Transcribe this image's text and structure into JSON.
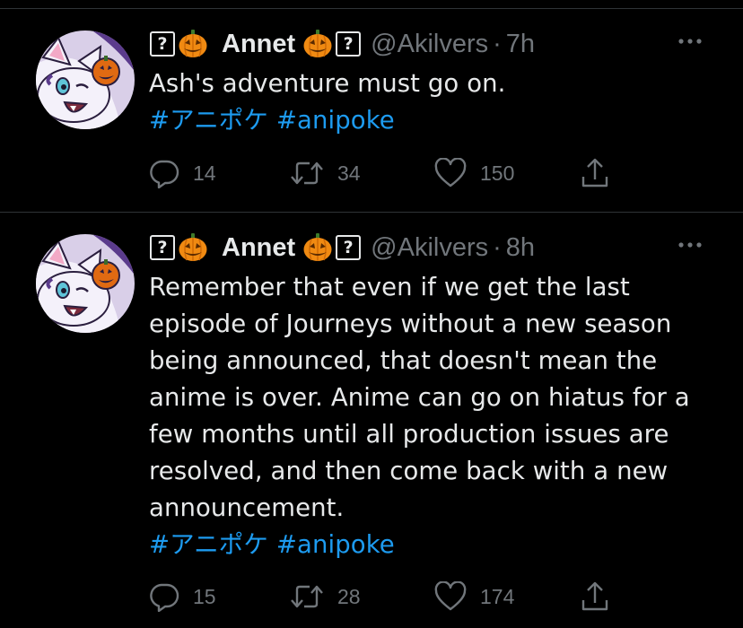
{
  "tweets": [
    {
      "name": "Annet",
      "name_prefix_badge": "?",
      "name_suffix_badge": "?",
      "handle": "@Akilvers",
      "separator": "·",
      "time": "7h",
      "text_lines": [
        "Ash's adventure must go on."
      ],
      "hashtags": [
        "#アニポケ",
        "#anipoke"
      ],
      "replies": "14",
      "retweets": "34",
      "likes": "150"
    },
    {
      "name": "Annet",
      "name_prefix_badge": "?",
      "name_suffix_badge": "?",
      "handle": "@Akilvers",
      "separator": "·",
      "time": "8h",
      "text_lines": [
        "Remember that even if we get the last",
        "episode of Journeys without a new season",
        "being announced, that doesn't mean the",
        "anime is over. Anime can go on hiatus for a",
        "few months until all production issues are",
        "resolved, and then come back with a new",
        "announcement."
      ],
      "hashtags": [
        "#アニポケ",
        "#anipoke"
      ],
      "replies": "15",
      "retweets": "28",
      "likes": "174"
    }
  ],
  "colors": {
    "background": "#000000",
    "text": "#e7e9ea",
    "muted": "#71767b",
    "link": "#1d9bf0",
    "divider": "#2f3336"
  },
  "icons": {
    "reply": "reply-bubble-icon",
    "retweet": "retweet-arrows-icon",
    "like": "heart-icon",
    "share": "share-upload-icon",
    "more": "more-dots-icon",
    "pumpkin": "jack-o-lantern-emoji"
  }
}
